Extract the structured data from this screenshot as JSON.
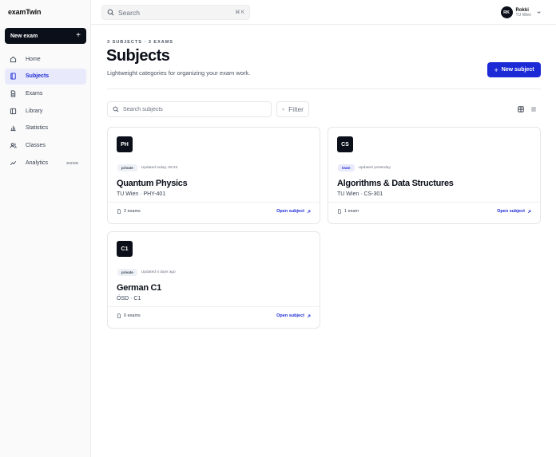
{
  "app": {
    "logo": "examTwin"
  },
  "sidebar": {
    "new_exam_label": "New exam",
    "items": [
      {
        "label": "Home",
        "icon": "home-icon",
        "active": false,
        "soon": ""
      },
      {
        "label": "Subjects",
        "icon": "book-icon",
        "active": true,
        "soon": ""
      },
      {
        "label": "Exams",
        "icon": "document-icon",
        "active": false,
        "soon": ""
      },
      {
        "label": "Library",
        "icon": "library-icon",
        "active": false,
        "soon": ""
      },
      {
        "label": "Statistics",
        "icon": "bar-chart-icon",
        "active": false,
        "soon": ""
      },
      {
        "label": "Classes",
        "icon": "users-icon",
        "active": false,
        "soon": ""
      },
      {
        "label": "Analytics",
        "icon": "analytics-icon",
        "active": false,
        "soon": "SOON"
      }
    ]
  },
  "topbar": {
    "search_placeholder": "Search",
    "shortcut": "⌘ K",
    "user": {
      "initials": "RK",
      "name": "Rokki",
      "org": "TU Wien"
    }
  },
  "header": {
    "eyebrow": "3 SUBJECTS · 3 EXAMS",
    "title": "Subjects",
    "subtitle": "Lightweight categories for organizing your exam work.",
    "new_subject_label": "New subject"
  },
  "toolbar": {
    "search_placeholder": "Search subjects",
    "filter_label": "Filter"
  },
  "subjects": [
    {
      "abbr": "PH",
      "visibility": "private",
      "updated": "Updated today, 09:42",
      "name": "Quantum Physics",
      "meta": "TU Wien · PHY-401",
      "exams": "2 exams",
      "open_label": "Open subject"
    },
    {
      "abbr": "CS",
      "visibility": "team",
      "updated": "Updated yesterday",
      "name": "Algorithms & Data Structures",
      "meta": "TU Wien · CS-301",
      "exams": "1 exam",
      "open_label": "Open subject"
    },
    {
      "abbr": "C1",
      "visibility": "private",
      "updated": "Updated 4 days ago",
      "name": "German C1",
      "meta": "ÖSD · C1",
      "exams": "0 exams",
      "open_label": "Open subject"
    }
  ],
  "colors": {
    "accent": "#1d2bd6",
    "dark": "#0b0f19",
    "active_bg": "#e8eafc"
  }
}
